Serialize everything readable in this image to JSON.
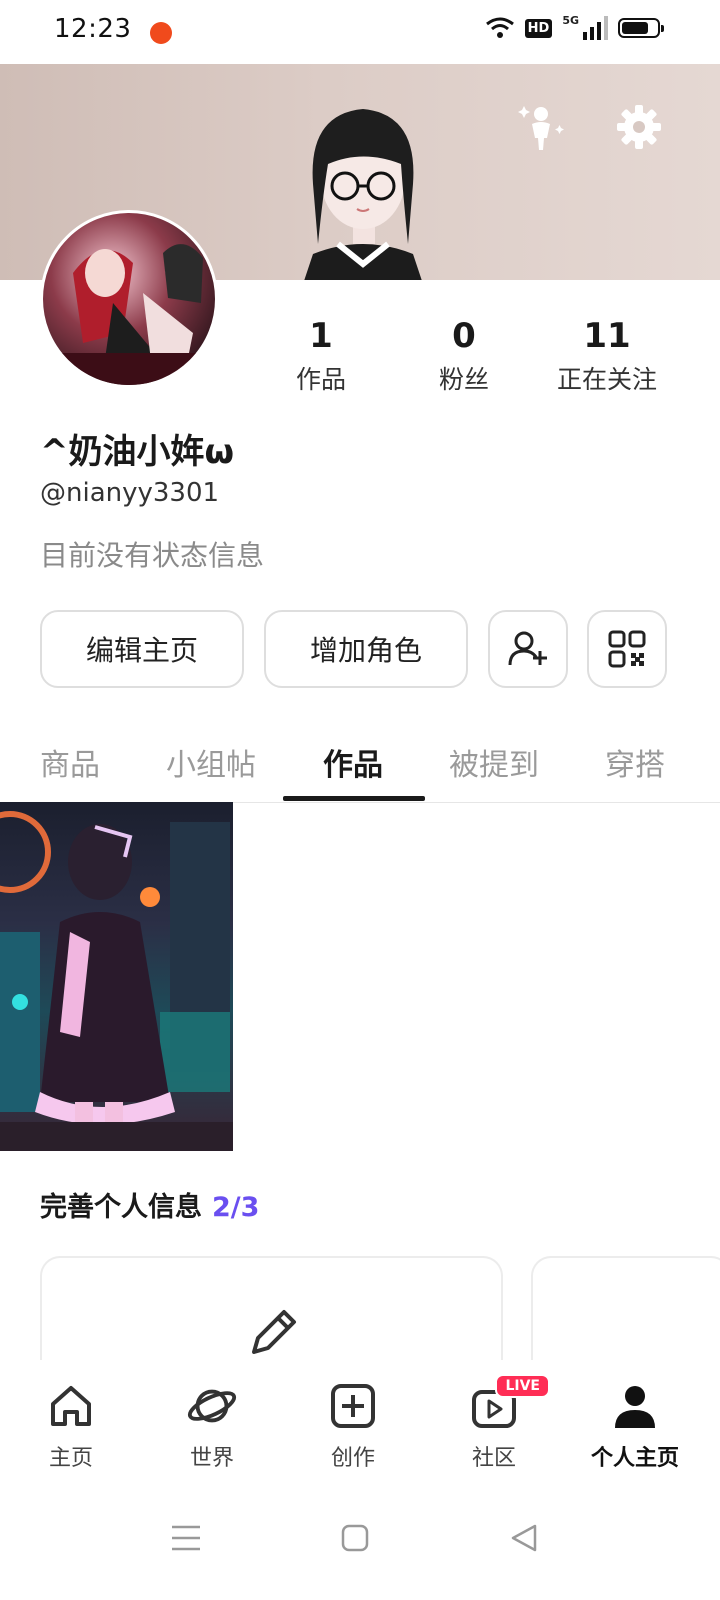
{
  "status_bar": {
    "time": "12:23",
    "hd": "HD",
    "net": "5G"
  },
  "profile": {
    "display_name": "^奶油小姩ω",
    "handle": "@nianyy3301",
    "bio": "目前没有状态信息",
    "stats": [
      {
        "value": "1",
        "label": "作品"
      },
      {
        "value": "0",
        "label": "粉丝"
      },
      {
        "value": "11",
        "label": "正在关注"
      }
    ]
  },
  "actions": {
    "edit_label": "编辑主页",
    "add_role_label": "增加角色"
  },
  "tabs": [
    {
      "label": "商品"
    },
    {
      "label": "小组帖"
    },
    {
      "label": "作品",
      "active": true
    },
    {
      "label": "被提到"
    },
    {
      "label": "穿搭"
    }
  ],
  "complete_profile": {
    "title": "完善个人信息",
    "progress": "2/3"
  },
  "bottom_nav": [
    {
      "label": "主页",
      "icon": "home-icon"
    },
    {
      "label": "世界",
      "icon": "planet-icon"
    },
    {
      "label": "创作",
      "icon": "create-plus-icon"
    },
    {
      "label": "社区",
      "icon": "community-play-icon",
      "badge": "LIVE"
    },
    {
      "label": "个人主页",
      "icon": "person-icon",
      "active": true
    }
  ],
  "colors": {
    "accent": "#6a4ff0",
    "live": "#ff2d55",
    "text": "#1a1a1a",
    "muted": "#8a8a8a"
  }
}
